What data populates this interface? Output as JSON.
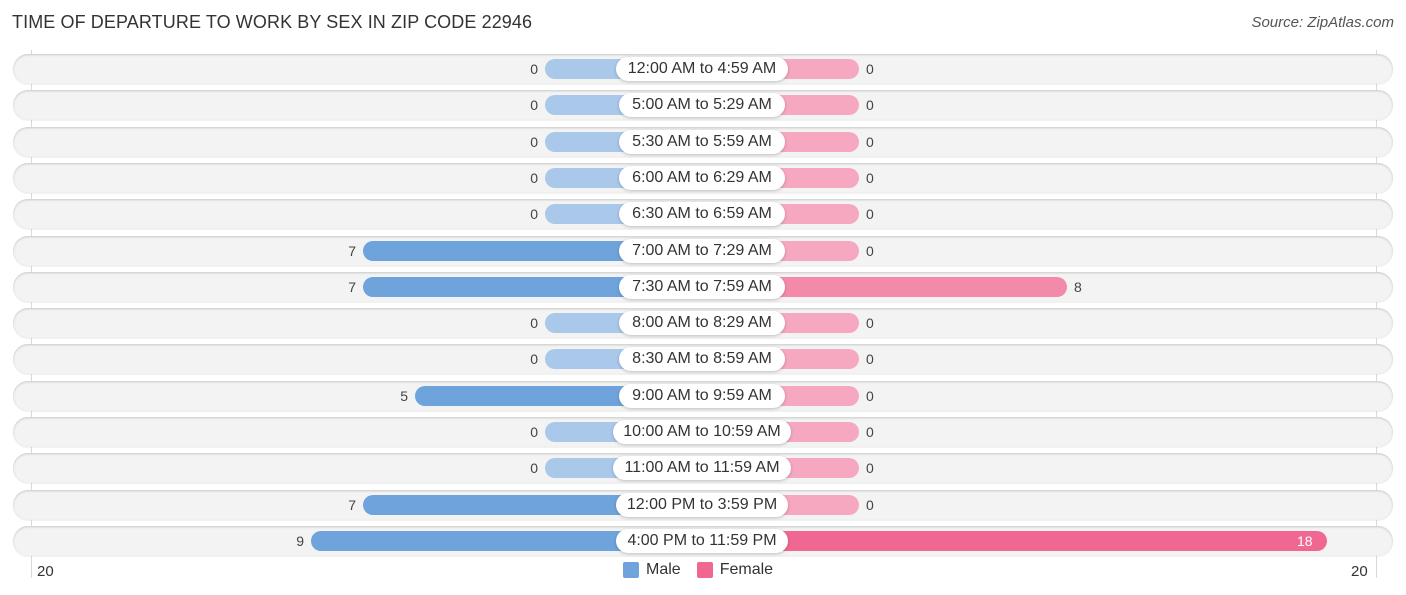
{
  "title": "TIME OF DEPARTURE TO WORK BY SEX IN ZIP CODE 22946",
  "source": "Source: ZipAtlas.com",
  "colors": {
    "male": "#6fa3dc",
    "female": "#f06892"
  },
  "legend": [
    {
      "key": "male",
      "label": "Male"
    },
    {
      "key": "female",
      "label": "Female"
    }
  ],
  "axis": {
    "left_label": "20",
    "right_label": "20"
  },
  "chart_data": {
    "type": "bar",
    "orientation": "horizontal-diverging",
    "title": "TIME OF DEPARTURE TO WORK BY SEX IN ZIP CODE 22946",
    "categories": [
      "12:00 AM to 4:59 AM",
      "5:00 AM to 5:29 AM",
      "5:30 AM to 5:59 AM",
      "6:00 AM to 6:29 AM",
      "6:30 AM to 6:59 AM",
      "7:00 AM to 7:29 AM",
      "7:30 AM to 7:59 AM",
      "8:00 AM to 8:29 AM",
      "8:30 AM to 8:59 AM",
      "9:00 AM to 9:59 AM",
      "10:00 AM to 10:59 AM",
      "11:00 AM to 11:59 AM",
      "12:00 PM to 3:59 PM",
      "4:00 PM to 11:59 PM"
    ],
    "series": [
      {
        "name": "Male",
        "values": [
          0,
          0,
          0,
          0,
          0,
          7,
          7,
          0,
          0,
          5,
          0,
          0,
          7,
          9
        ]
      },
      {
        "name": "Female",
        "values": [
          0,
          0,
          0,
          0,
          0,
          0,
          8,
          0,
          0,
          0,
          0,
          0,
          0,
          18
        ]
      }
    ],
    "xlim": [
      -20,
      20
    ],
    "tick_labels": [
      "20",
      "20"
    ],
    "legend_position": "bottom-center",
    "grid": false
  }
}
